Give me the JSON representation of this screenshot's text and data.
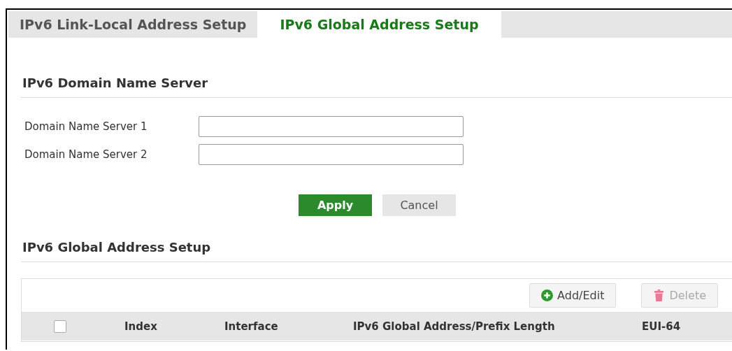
{
  "tabs": [
    {
      "label": "IPv6 Link-Local Address Setup",
      "selected": false
    },
    {
      "label": "IPv6 Global Address Setup",
      "selected": true
    }
  ],
  "dns_section": {
    "title": "IPv6 Domain Name Server",
    "fields": [
      {
        "label": "Domain Name Server 1"
      },
      {
        "label": "Domain Name Server 2"
      }
    ],
    "buttons": [
      {
        "label": "Apply",
        "kind": "primary"
      },
      {
        "label": "Cancel",
        "kind": "secondary"
      }
    ]
  },
  "global_section": {
    "title": "IPv6 Global Address Setup",
    "toolbar": [
      {
        "label": "Add/Edit",
        "kind": "add",
        "disabled": false
      },
      {
        "label": "Delete",
        "kind": "delete",
        "disabled": true
      }
    ],
    "table": {
      "select_all_checked": false,
      "columns": [
        "Index",
        "Interface",
        "IPv6 Global Address/Prefix Length",
        "EUI-64"
      ]
    }
  }
}
